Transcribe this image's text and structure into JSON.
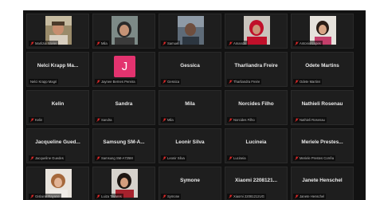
{
  "colors": {
    "background": "#121212",
    "tile": "#1e1e1e",
    "muted_mic": "#e02828",
    "avatar_j": "#e3336f"
  },
  "tiles": [
    {
      "display": "",
      "label": "Marlizia Xavier",
      "photo": "p1"
    },
    {
      "display": "",
      "label": "Mila",
      "photo": "p2"
    },
    {
      "display": "",
      "label": "Samuel",
      "photo": "p3"
    },
    {
      "display": "",
      "label": "Amanda",
      "photo": "p4"
    },
    {
      "display": "",
      "label": "Antonio Lopes",
      "photo": "p5"
    },
    {
      "display": "Nelci Krapp Ma...",
      "label": "Nelci Krapp Magri"
    },
    {
      "display": "",
      "label": "Jaynee Bernes Pereira",
      "avatar": "J"
    },
    {
      "display": "Gessica",
      "label": "Gessica"
    },
    {
      "display": "Tharliandra Freire",
      "label": "Tharliandra Freire"
    },
    {
      "display": "Odete Martins",
      "label": "Odete Martins"
    },
    {
      "display": "Kelin",
      "label": "Kelin"
    },
    {
      "display": "Sandra",
      "label": "Sandra"
    },
    {
      "display": "Mila",
      "label": "Mila"
    },
    {
      "display": "Norcides Filho",
      "label": "Norcides Filho"
    },
    {
      "display": "Nathieli Rosenau",
      "label": "Nathieli Rosenau"
    },
    {
      "display": "Jacqueline Gued...",
      "label": "Jacqueline Guedes"
    },
    {
      "display": "Samsung SM-A...",
      "label": "Samsung SM-A725M"
    },
    {
      "display": "Leonir Silva",
      "label": "Leonir Silva"
    },
    {
      "display": "Lucineia",
      "label": "Lucineia"
    },
    {
      "display": "Meriele Prestes...",
      "label": "Meriele Prestes Corrêa"
    },
    {
      "display": "",
      "label": "Gislaine Rayane",
      "photo": "p6"
    },
    {
      "display": "",
      "label": "Luiza Tavares",
      "photo": "p7"
    },
    {
      "display": "Symone",
      "label": "Symone"
    },
    {
      "display": "Xiaomi 2208121...",
      "label": "Xiaomi 22081212UG"
    },
    {
      "display": "Janete Henschel",
      "label": "Janete Henschel"
    }
  ]
}
